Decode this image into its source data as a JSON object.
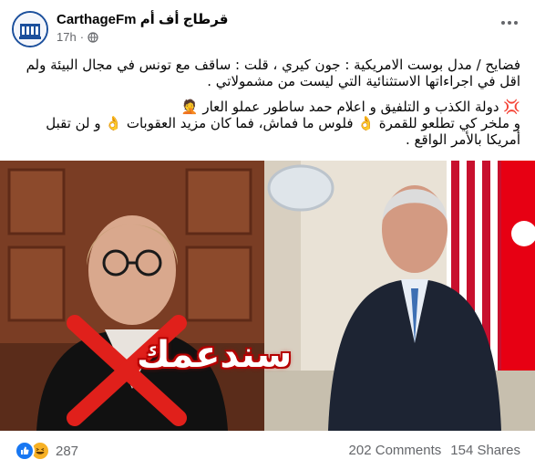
{
  "post": {
    "page_name": "CarthageFm قرطاج أف أم",
    "time": "17h",
    "separator": "·",
    "privacy_icon": "globe-icon",
    "more_icon": "more-options-icon",
    "paragraphs": [
      "فضايح / مدل بوست الامريكية : جون كيري ، قلت : ساقف مع تونس في مجال البيئة ولم اقل في اجراءاتها الاستثنائية التي ليست من مشمولاتي .",
      "💢 دولة الكذب و التلفيق و اعلام حمد ساطور عملو العار 🤦",
      "و ملخر كي تطلعو للقمرة 👌 فلوس ما فماش، فما كان مزيد العقوبات 👌 و لن تقبل أمريكا بالأمر الواقع ."
    ],
    "image_overlay_text": "سندعمك"
  },
  "footer": {
    "reaction_count": "287",
    "comments": "202 Comments",
    "shares": "154 Shares"
  },
  "colors": {
    "like": "#1877f2",
    "haha": "#f7b125",
    "secondary_text": "#65676b",
    "x_mark": "#e0201b"
  }
}
